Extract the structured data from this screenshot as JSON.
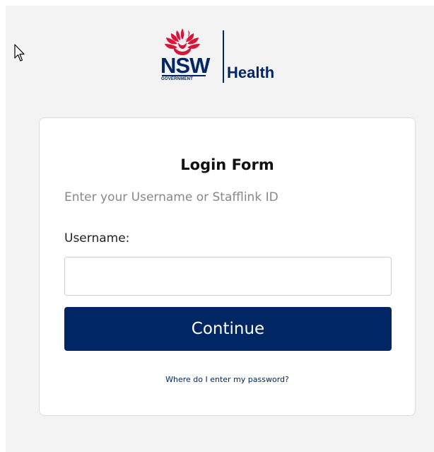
{
  "logo": {
    "nsw_label": "NSW",
    "government_label": "GOVERNMENT",
    "health_label": "Health",
    "colors": {
      "navy": "#002664",
      "waratah_red": "#d7153a"
    }
  },
  "form": {
    "title": "Login Form",
    "subtitle": "Enter your Username or Stafflink ID",
    "username_label": "Username:",
    "username_value": "",
    "username_placeholder": "",
    "continue_label": "Continue",
    "password_link": "Where do I enter my password?"
  },
  "icons": {
    "cursor": "mouse-pointer-icon",
    "waratah": "waratah-flower-icon"
  }
}
